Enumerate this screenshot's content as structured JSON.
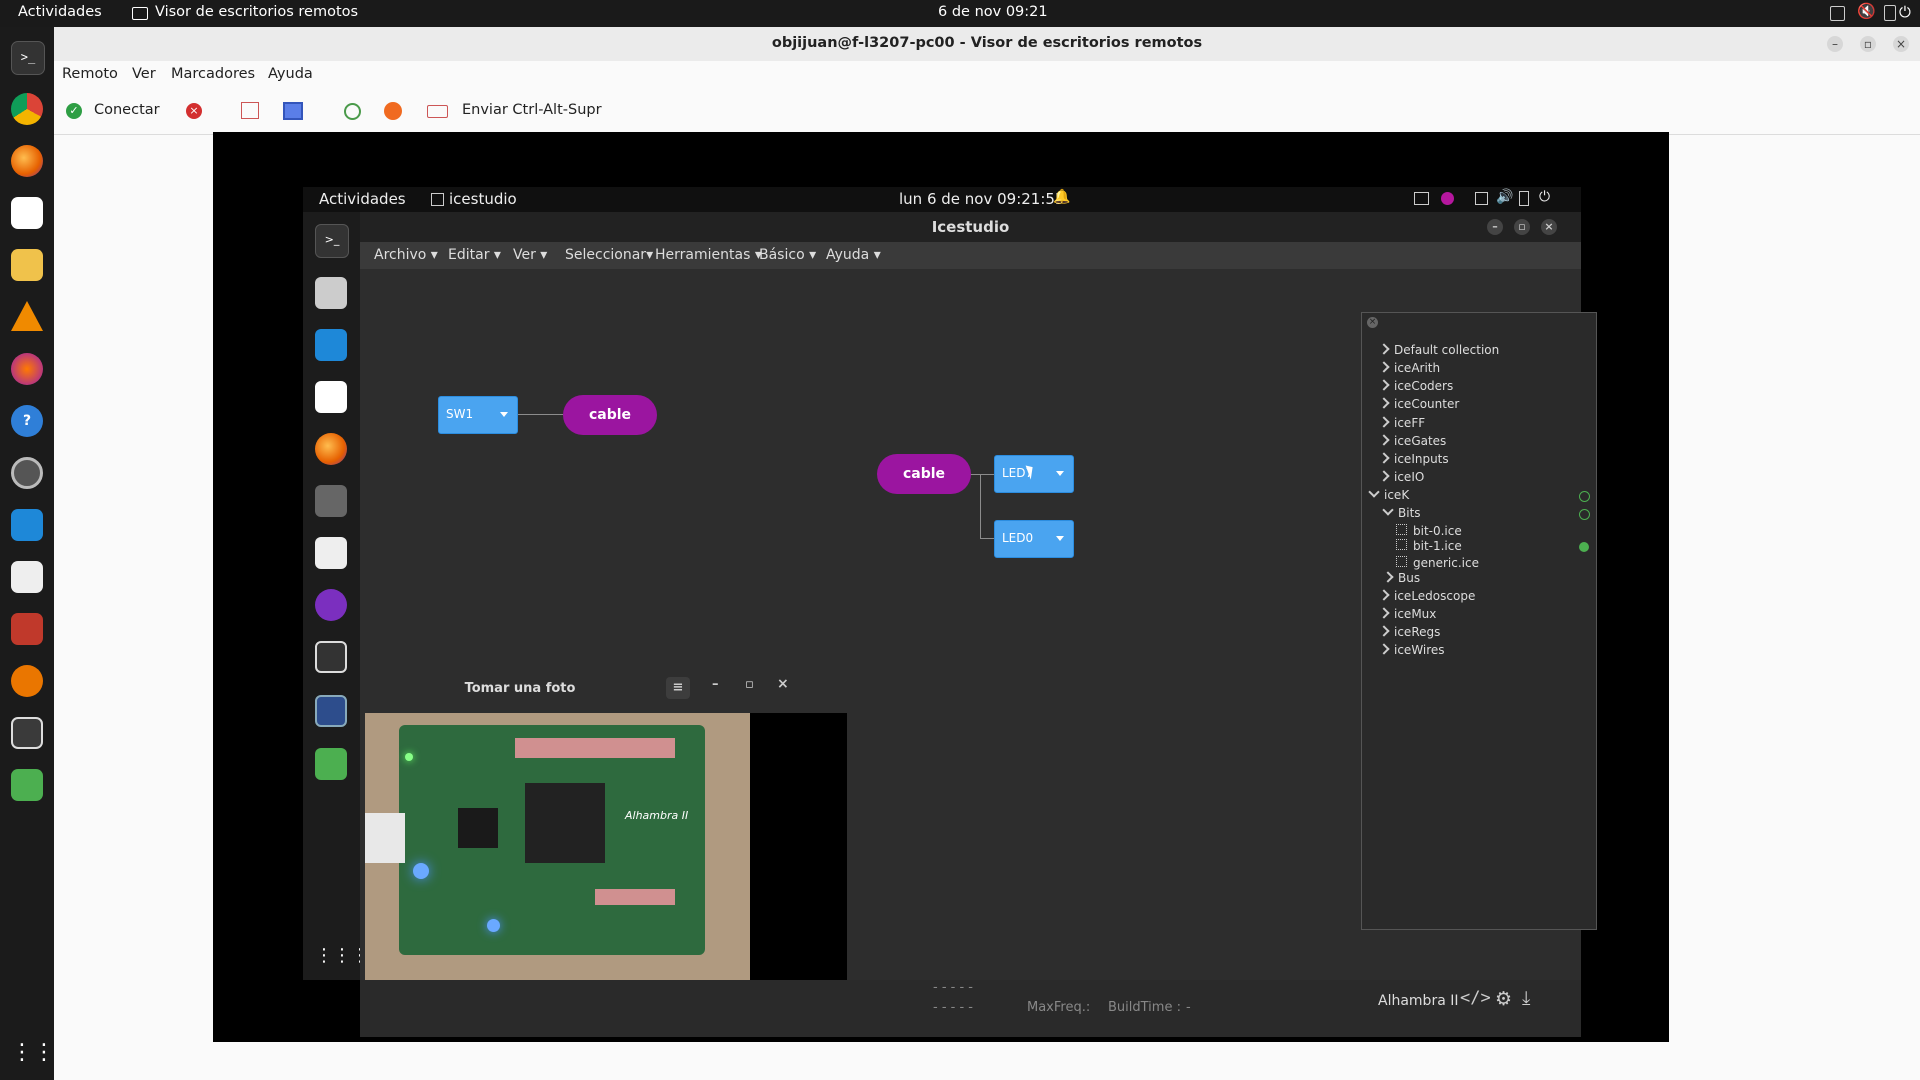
{
  "host_topbar": {
    "activities": "Actividades",
    "app": "Visor de escritorios remotos",
    "datetime": "6 de nov  09:21"
  },
  "window": {
    "title": "objijuan@f-l3207-pc00 - Visor de escritorios remotos"
  },
  "menu": [
    "Remoto",
    "Ver",
    "Marcadores",
    "Ayuda"
  ],
  "toolbar": {
    "connect_label": "Conectar",
    "send_cad_label": "Enviar Ctrl-Alt-Supr"
  },
  "remote_topbar": {
    "activities": "Actividades",
    "app": "icestudio",
    "datetime": "lun 6 de nov  09:21:55"
  },
  "icestudio": {
    "title": "Icestudio",
    "menu": [
      "Archivo",
      "Editar",
      "Ver",
      "Seleccionar",
      "Herramientas",
      "Básico",
      "Ayuda"
    ],
    "blocks": {
      "sw1": "SW1",
      "led7": "LED7",
      "led0": "LED0",
      "cable_a": "cable",
      "cable_b": "cable"
    },
    "collections": {
      "top": [
        "Default collection",
        "iceArith",
        "iceCoders",
        "iceCounter",
        "iceFF",
        "iceGates",
        "iceInputs",
        "iceIO"
      ],
      "icek": "iceK",
      "bits": "Bits",
      "bit_files": [
        "bit-0.ice",
        "bit-1.ice",
        "generic.ice"
      ],
      "bus": "Bus",
      "bottom": [
        "iceLedoscope",
        "iceMux",
        "iceRegs",
        "iceWires"
      ]
    },
    "status": {
      "maxfreq": "MaxFreq.:",
      "buildtime": "BuildTime :",
      "dash": "-",
      "board": "Alhambra II"
    }
  },
  "photo_window": {
    "title": "Tomar una foto",
    "board_label": "Alhambra II"
  }
}
